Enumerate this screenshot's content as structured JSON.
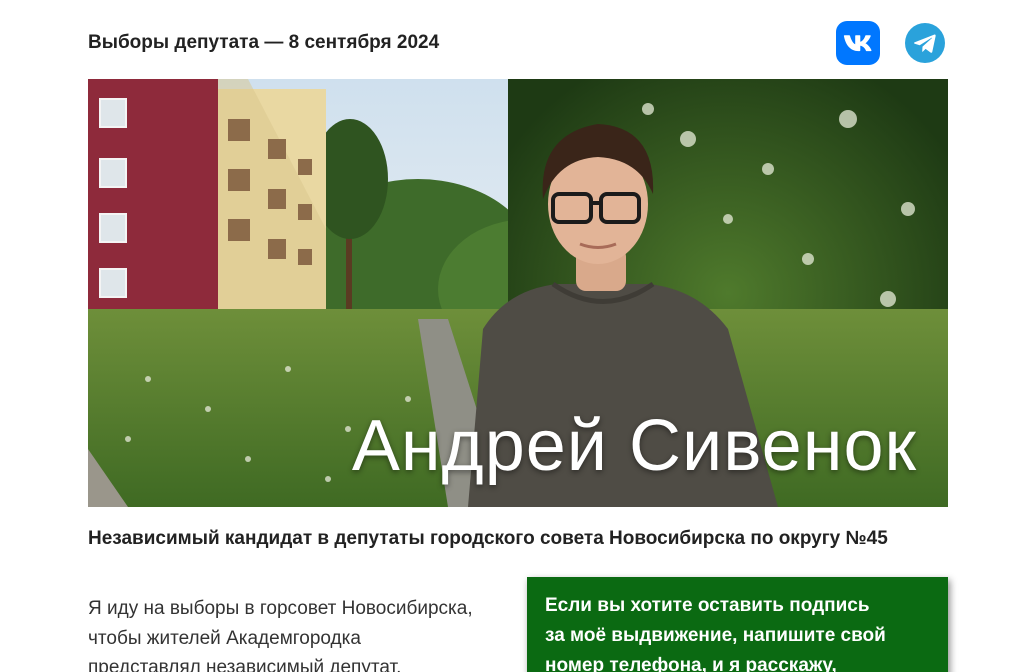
{
  "header": {
    "title": "Выборы депутата — 8 сентября 2024",
    "socials": [
      {
        "name": "VK",
        "icon": "vk-icon",
        "color": "#0077ff"
      },
      {
        "name": "Telegram",
        "icon": "telegram-icon",
        "color": "#2aa2db"
      }
    ]
  },
  "hero": {
    "candidate_name": "Андрей Сивенок"
  },
  "subtitle": "Независимый кандидат в депутаты городского совета Новосибирска по округу №45",
  "intro": {
    "lines": [
      "Я иду на выборы в горсовет Новосибирска,",
      "чтобы жителей Академгородка",
      "представлял независимый депутат."
    ]
  },
  "cta": {
    "lines": [
      "Если вы хотите оставить подпись",
      "за моё выдвижение, напишите свой",
      "номер телефона, и я расскажу,"
    ],
    "background": "#0b6a12"
  }
}
